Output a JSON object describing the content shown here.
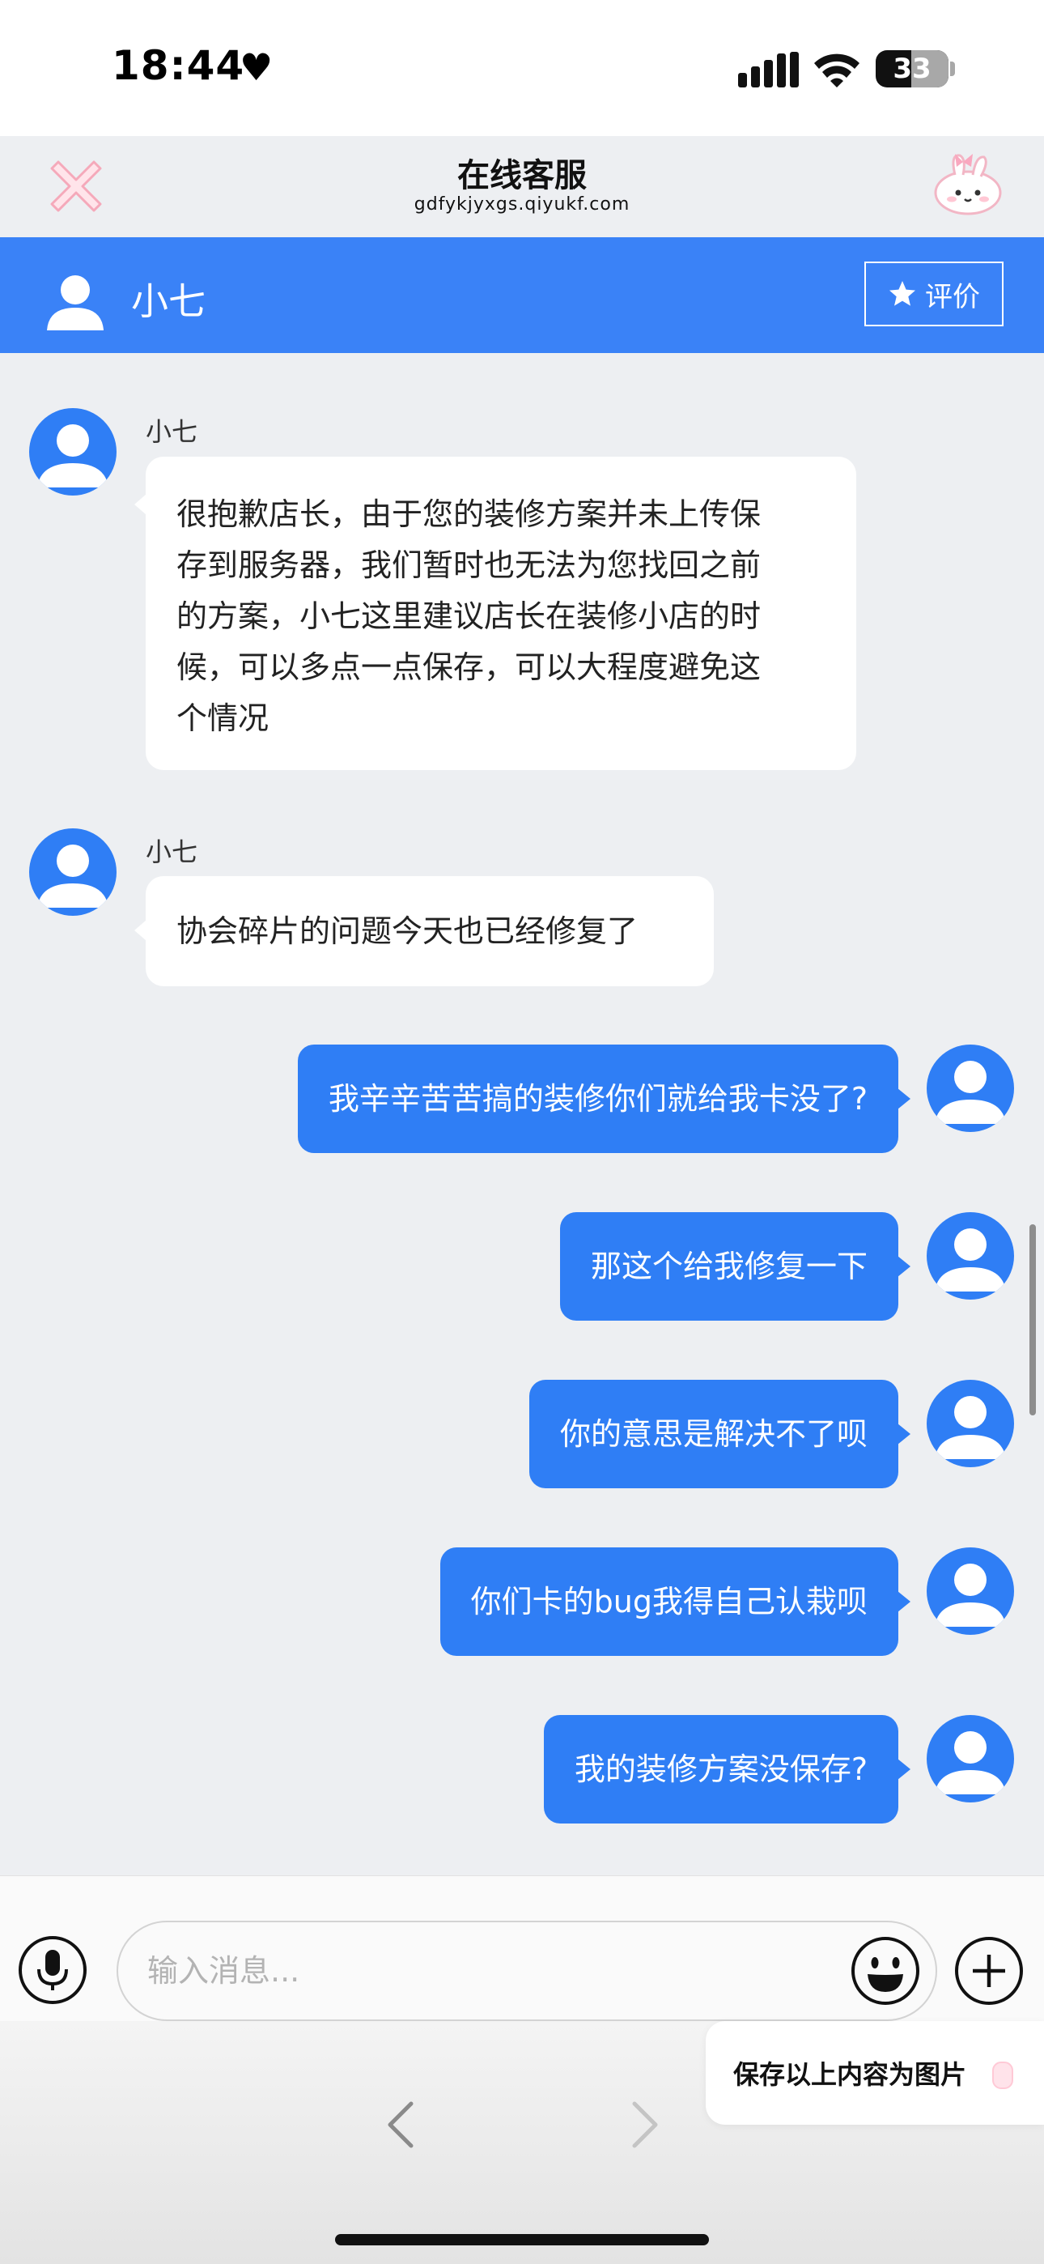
{
  "status_bar": {
    "time": "18:44",
    "heart_icon": "heart-icon",
    "signal_icon": "cellular-signal-icon",
    "wifi_icon": "wifi-icon",
    "battery_level": "33"
  },
  "nav": {
    "title": "在线客服",
    "url": "gdfykjyxgs.qiyukf.com",
    "close_icon": "close-x-icon",
    "mascot_icon": "bunny-mascot-icon"
  },
  "agent_bar": {
    "name": "小七",
    "rate_label": "评价",
    "accent_color": "#3a82f7"
  },
  "messages": [
    {
      "from": "agent",
      "sender": "小七",
      "lines": [
        "很抱歉店长，由于您的装修方案并未上传保",
        "存到服务器，我们暂时也无法为您找回之前",
        "的方案，小七这里建议店长在装修小店的时",
        "候，可以多点一点保存，可以大程度避免这",
        "个情况"
      ]
    },
    {
      "from": "agent",
      "sender": "小七",
      "text": "协会碎片的问题今天也已经修复了"
    },
    {
      "from": "user",
      "text": "我辛辛苦苦搞的装修你们就给我卡没了?"
    },
    {
      "from": "user",
      "text": "那这个给我修复一下"
    },
    {
      "from": "user",
      "text": "你的意思是解决不了呗"
    },
    {
      "from": "user",
      "text": "你们卡的bug我得自己认栽呗"
    },
    {
      "from": "user",
      "text": "我的装修方案没保存?"
    }
  ],
  "input": {
    "placeholder": "输入消息...",
    "value": ""
  },
  "bottom": {
    "save_popup_label": "保存以上内容为图片"
  }
}
